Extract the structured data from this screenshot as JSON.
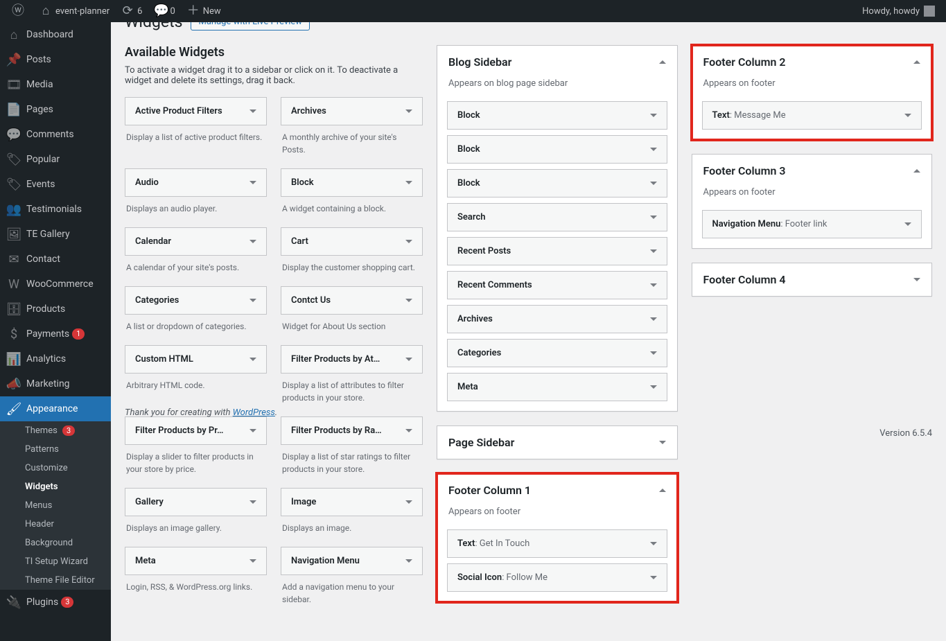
{
  "adminbar": {
    "site_name": "event-planner",
    "updates": "6",
    "comments": "0",
    "new_label": "New",
    "howdy": "Howdy, howdy"
  },
  "menu": {
    "items": [
      {
        "label": "Dashboard",
        "icon": "⌂"
      },
      {
        "label": "Posts",
        "icon": "📌"
      },
      {
        "label": "Media",
        "icon": "🎞"
      },
      {
        "label": "Pages",
        "icon": "📄"
      },
      {
        "label": "Comments",
        "icon": "💬"
      },
      {
        "label": "Popular",
        "icon": "🏷"
      },
      {
        "label": "Events",
        "icon": "🏷"
      },
      {
        "label": "Testimonials",
        "icon": "👥"
      },
      {
        "label": "TE Gallery",
        "icon": "🖼"
      },
      {
        "label": "Contact",
        "icon": "✉"
      },
      {
        "label": "WooCommerce",
        "icon": "W",
        "badge": null
      },
      {
        "label": "Products",
        "icon": "🗄"
      },
      {
        "label": "Payments",
        "icon": "$",
        "badge": "1"
      },
      {
        "label": "Analytics",
        "icon": "📊"
      },
      {
        "label": "Marketing",
        "icon": "📣"
      },
      {
        "label": "Appearance",
        "icon": "🖌",
        "current": true
      },
      {
        "label": "Plugins",
        "icon": "🔌",
        "badge": "3"
      }
    ],
    "submenu": [
      {
        "label": "Themes",
        "badge": "3"
      },
      {
        "label": "Patterns"
      },
      {
        "label": "Customize"
      },
      {
        "label": "Widgets",
        "current": true
      },
      {
        "label": "Menus"
      },
      {
        "label": "Header"
      },
      {
        "label": "Background"
      },
      {
        "label": "TI Setup Wizard"
      },
      {
        "label": "Theme File Editor"
      }
    ]
  },
  "page": {
    "title": "Widgets",
    "live_preview": "Manage with Live Preview",
    "available_h": "Available Widgets",
    "available_desc": "To activate a widget drag it to a sidebar or click on it. To deactivate a widget and delete its settings, drag it back.",
    "thank_you": "Thank you for creating with ",
    "wp_link": "WordPress",
    "version": "Version 6.5.4"
  },
  "available": [
    {
      "t": "Active Product Filters",
      "d": "Display a list of active product filters."
    },
    {
      "t": "Archives",
      "d": "A monthly archive of your site's Posts."
    },
    {
      "t": "Audio",
      "d": "Displays an audio player."
    },
    {
      "t": "Block",
      "d": "A widget containing a block."
    },
    {
      "t": "Calendar",
      "d": "A calendar of your site's posts."
    },
    {
      "t": "Cart",
      "d": "Display the customer shopping cart."
    },
    {
      "t": "Categories",
      "d": "A list or dropdown of categories."
    },
    {
      "t": "Contct Us",
      "d": "Widget for About Us section"
    },
    {
      "t": "Custom HTML",
      "d": "Arbitrary HTML code."
    },
    {
      "t": "Filter Products by At…",
      "d": "Display a list of attributes to filter products in your store."
    },
    {
      "t": "Filter Products by Pr…",
      "d": "Display a slider to filter products in your store by price."
    },
    {
      "t": "Filter Products by Ra…",
      "d": "Display a list of star ratings to filter products in your store."
    },
    {
      "t": "Gallery",
      "d": "Displays an image gallery."
    },
    {
      "t": "Image",
      "d": "Displays an image."
    },
    {
      "t": "Meta",
      "d": "Login, RSS, & WordPress.org links."
    },
    {
      "t": "Navigation Menu",
      "d": "Add a navigation menu to your sidebar."
    }
  ],
  "sidebars_left": [
    {
      "title": "Blog Sidebar",
      "desc": "Appears on blog page sidebar",
      "open": true,
      "hl": false,
      "widgets": [
        {
          "t": "Block"
        },
        {
          "t": "Block"
        },
        {
          "t": "Block"
        },
        {
          "t": "Search"
        },
        {
          "t": "Recent Posts"
        },
        {
          "t": "Recent Comments"
        },
        {
          "t": "Archives"
        },
        {
          "t": "Categories"
        },
        {
          "t": "Meta"
        }
      ]
    },
    {
      "title": "Page Sidebar",
      "open": false,
      "hl": false
    },
    {
      "title": "Footer Column 1",
      "desc": "Appears on footer",
      "open": true,
      "hl": true,
      "widgets": [
        {
          "t": "Text",
          "sub": ": Get In Touch"
        },
        {
          "t": "Social Icon",
          "sub": ": Follow Me"
        }
      ]
    }
  ],
  "sidebars_right": [
    {
      "title": "Footer Column 2",
      "desc": "Appears on footer",
      "open": true,
      "hl": true,
      "widgets": [
        {
          "t": "Text",
          "sub": ": Message Me"
        }
      ]
    },
    {
      "title": "Footer Column 3",
      "desc": "Appears on footer",
      "open": true,
      "hl": false,
      "widgets": [
        {
          "t": "Navigation Menu",
          "sub": ": Footer link"
        }
      ]
    },
    {
      "title": "Footer Column 4",
      "open": false,
      "hl": false
    }
  ]
}
